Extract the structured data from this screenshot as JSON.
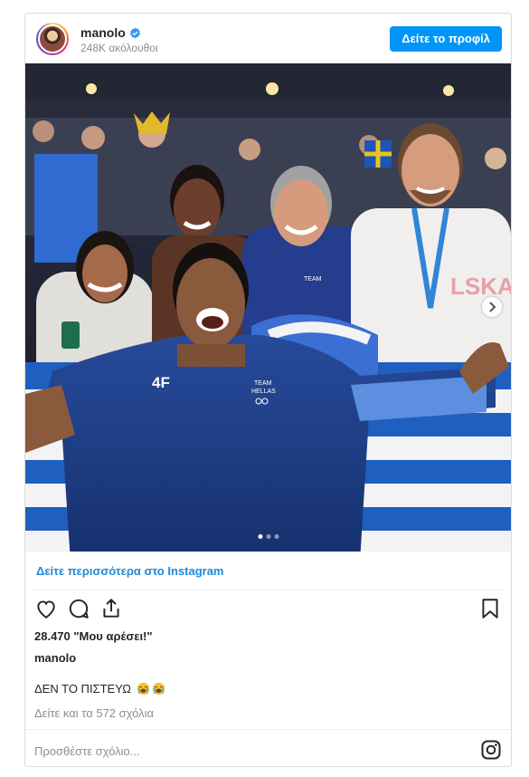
{
  "header": {
    "username": "manolo",
    "followers": "248K ακόλουθοι",
    "profile_button": "Δείτε το προφίλ"
  },
  "post": {
    "image_icon": "photo-of-celebrating-greek-athlete",
    "carousel_total": 3,
    "carousel_active": 1,
    "more_on_instagram": "Δείτε περισσότερα στο Instagram",
    "likes": "28.470 \"Μου αρέσει!\"",
    "caption_user": "manolo",
    "caption_text": "ΔΕΝ ΤΟ ΠΙΣΤΕΥΩ",
    "caption_emojis": [
      "crying-face-emoji",
      "crying-face-emoji"
    ],
    "comments_link": "Δείτε και τα 572 σχόλια",
    "comment_placeholder": "Προσθέστε σχόλιο..."
  },
  "icons": {
    "like": "heart-icon",
    "comment": "comment-icon",
    "share": "share-icon",
    "save": "bookmark-icon",
    "verified": "verified-badge-icon",
    "instagram": "instagram-logo-icon",
    "carousel": "chevron-right-icon"
  },
  "colors": {
    "accent": "#0095f6",
    "link": "#1e88d9",
    "muted": "#8e8e8e",
    "border": "#dbdbdb"
  }
}
